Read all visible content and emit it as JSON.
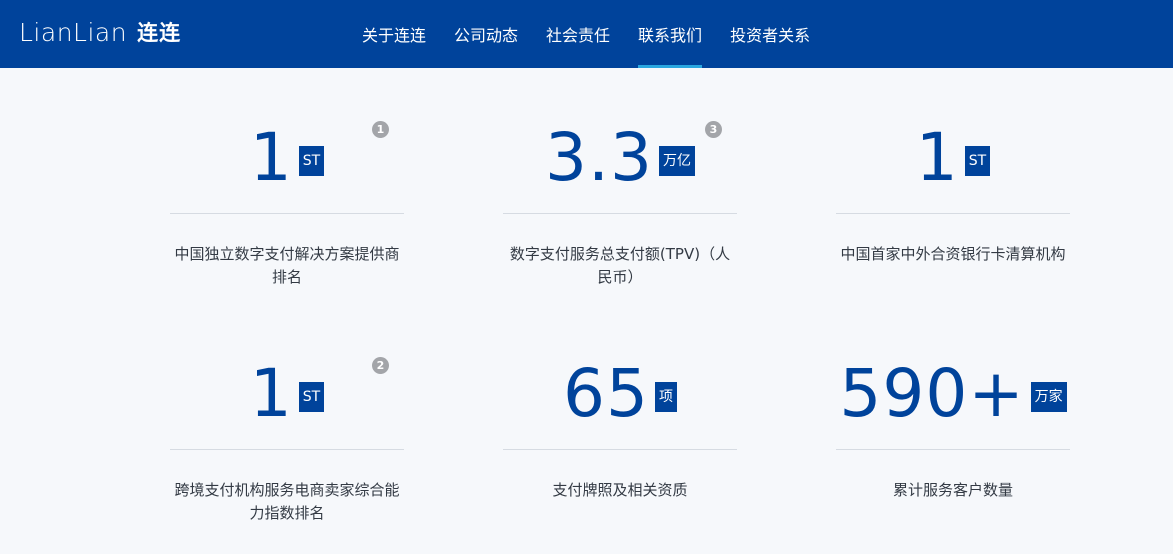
{
  "header": {
    "logo_latin": "LianLian",
    "logo_cn": "连连",
    "nav": [
      {
        "label": "关于连连",
        "active": false
      },
      {
        "label": "公司动态",
        "active": false
      },
      {
        "label": "社会责任",
        "active": false
      },
      {
        "label": "联系我们",
        "active": true
      },
      {
        "label": "投资者关系",
        "active": false
      }
    ]
  },
  "stats": [
    {
      "number": "1",
      "unit": "ST",
      "footnote": "1",
      "description": "中国独立数字支付解决方案提供商排名"
    },
    {
      "number": "3.3",
      "unit": "万亿",
      "footnote": "3",
      "description": "数字支付服务总支付额(TPV)（人民币）"
    },
    {
      "number": "1",
      "unit": "ST",
      "footnote": "",
      "description": "中国首家中外合资银行卡清算机构"
    },
    {
      "number": "1",
      "unit": "ST",
      "footnote": "2",
      "description": "跨境支付机构服务电商卖家综合能力指数排名"
    },
    {
      "number": "65",
      "unit": "项",
      "footnote": "",
      "description": "支付牌照及相关资质"
    },
    {
      "number": "590+",
      "unit": "万家",
      "footnote": "",
      "description": "累计服务客户数量"
    }
  ],
  "colors": {
    "brand_blue": "#00439b",
    "nav_active_underline": "#2aa7e0",
    "footnote_gray": "#a3a5a9"
  }
}
